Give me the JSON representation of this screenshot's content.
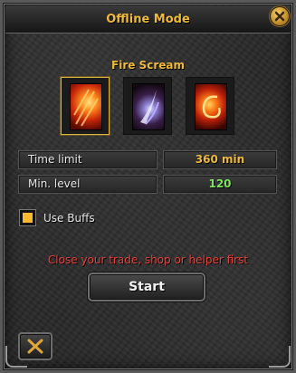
{
  "window": {
    "title": "Offline Mode",
    "close_icon": "x-icon"
  },
  "skill": {
    "selected_name": "Fire Scream",
    "options": [
      {
        "icon": "fire-scream-skill-icon",
        "selected": true
      },
      {
        "icon": "blade-skill-icon",
        "selected": false
      },
      {
        "icon": "fire-swirl-skill-icon",
        "selected": false
      }
    ]
  },
  "settings": {
    "time_limit_label": "Time limit",
    "time_limit_value": "360 min",
    "min_level_label": "Min. level",
    "min_level_value": "120"
  },
  "use_buffs": {
    "label": "Use Buffs",
    "checked": true
  },
  "warning_text": "Close your trade, shop or helper first",
  "start_label": "Start",
  "cancel_icon": "x-icon",
  "colors": {
    "title": "#f0b93a",
    "time_value": "#f0b93a",
    "level_value": "#7fe35b",
    "warning": "#e8413a",
    "checkbox": "#f5b82e"
  }
}
